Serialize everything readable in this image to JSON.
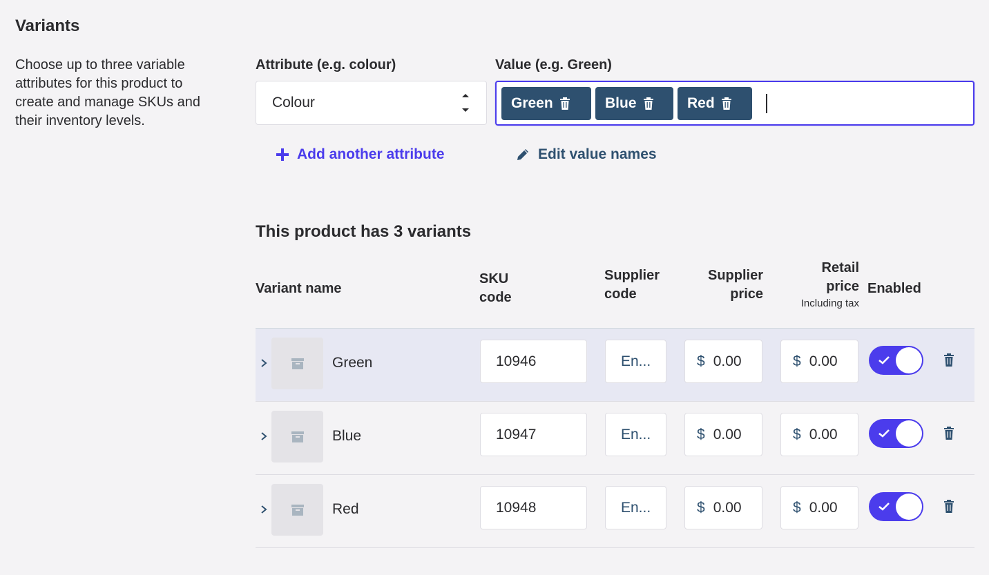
{
  "section": {
    "title": "Variants",
    "description": "Choose up to three variable attributes for this product to create and manage SKUs and their inventory levels."
  },
  "attribute": {
    "label": "Attribute (e.g. colour)",
    "selected": "Colour"
  },
  "value": {
    "label": "Value (e.g. Green)",
    "chips": [
      "Green",
      "Blue",
      "Red"
    ]
  },
  "actions": {
    "add_attribute": "Add another attribute",
    "edit_values": "Edit value names"
  },
  "variants": {
    "heading": "This product has 3 variants",
    "columns": {
      "name": "Variant name",
      "sku_line1": "SKU",
      "sku_line2": "code",
      "supplier_code_line1": "Supplier",
      "supplier_code_line2": "code",
      "supplier_price_line1": "Supplier",
      "supplier_price_line2": "price",
      "retail_price_line1": "Retail",
      "retail_price_line2": "price",
      "retail_price_sub": "Including tax",
      "enabled": "Enabled"
    },
    "currency_symbol": "$",
    "rows": [
      {
        "name": "Green",
        "sku": "10946",
        "supplier_code": "En...",
        "supplier_price": "0.00",
        "retail_price": "0.00",
        "enabled": true
      },
      {
        "name": "Blue",
        "sku": "10947",
        "supplier_code": "En...",
        "supplier_price": "0.00",
        "retail_price": "0.00",
        "enabled": true
      },
      {
        "name": "Red",
        "sku": "10948",
        "supplier_code": "En...",
        "supplier_price": "0.00",
        "retail_price": "0.00",
        "enabled": true
      }
    ]
  },
  "colors": {
    "accent": "#4b3cec",
    "chip": "#2e506f",
    "background": "#f4f3f5",
    "row_highlight": "#e7e8f3"
  },
  "icons": {
    "chip_remove": "trash-icon",
    "add": "plus-icon",
    "edit": "pencil-icon",
    "expand": "chevron-right-icon",
    "thumbnail": "archive-box-icon",
    "toggle": "check-icon",
    "row_delete": "trash-icon"
  }
}
